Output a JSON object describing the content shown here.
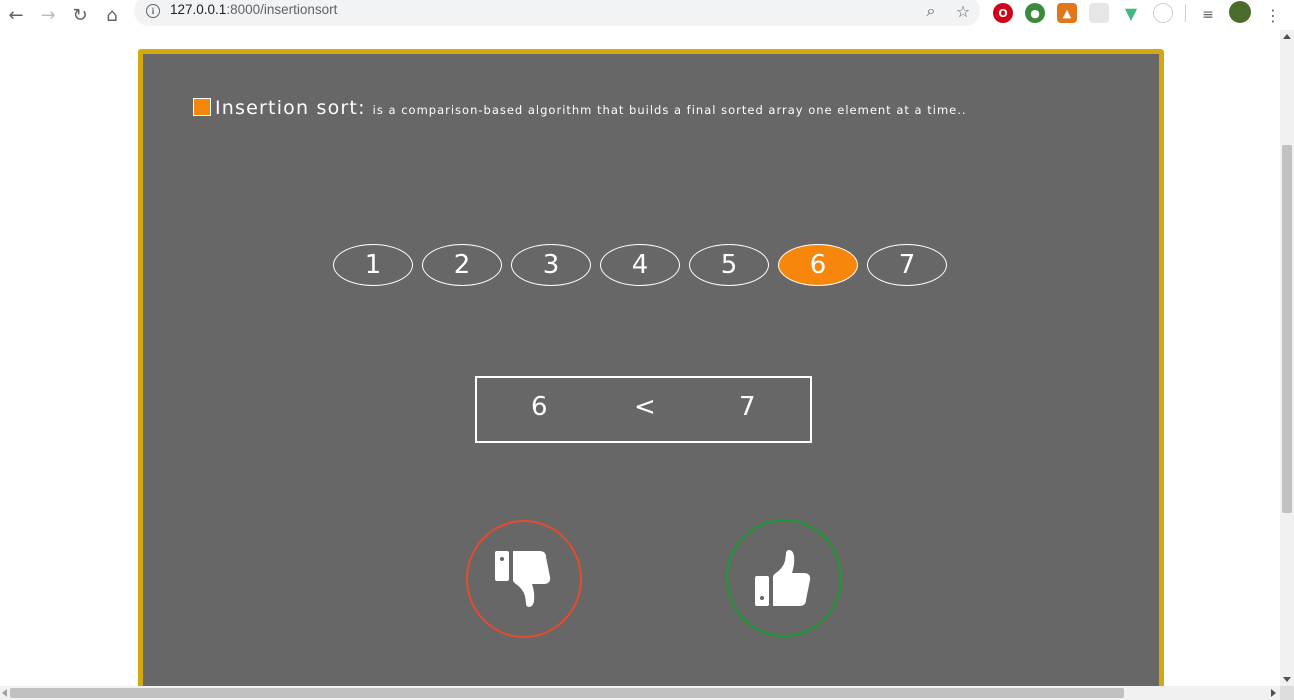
{
  "browser": {
    "url_host": "127.0.0.1",
    "url_path": ":8000/insertionsort"
  },
  "description": {
    "title": "Insertion sort:",
    "text": "is a comparison-based algorithm that builds a final sorted array one element at a time.."
  },
  "array": {
    "items": [
      "1",
      "2",
      "3",
      "4",
      "5",
      "6",
      "7"
    ],
    "active_index": 5
  },
  "comparison": {
    "left": "6",
    "operator": "<",
    "right": "7"
  },
  "colors": {
    "panel_bg": "#676767",
    "panel_border": "#d4a90f",
    "accent": "#f7870c",
    "thumbs_down": "#e44b2f",
    "thumbs_up": "#1c9b35"
  },
  "icons": {
    "false_button": "thumbs-down-icon",
    "true_button": "thumbs-up-icon"
  }
}
